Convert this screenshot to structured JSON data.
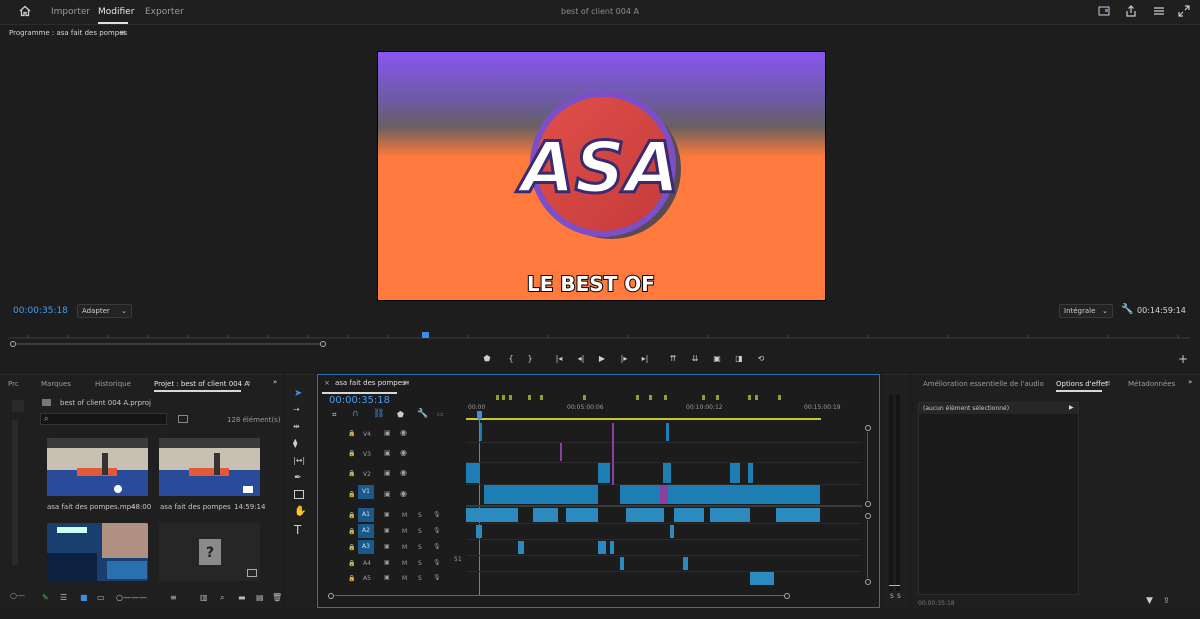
{
  "topbar": {
    "tabs": [
      "Importer",
      "Modifier",
      "Exporter"
    ],
    "active_tab": "Modifier",
    "document_title": "best of client 004 A"
  },
  "program": {
    "title": "Programme : asa fait des pompes",
    "timecode": "00:00:35:18",
    "fit_label": "Adapter",
    "quality_label": "Intégrale",
    "duration": "00:14:59:14",
    "video": {
      "logo_text": "ASA",
      "subtitle": "LE BEST OF"
    }
  },
  "project": {
    "truncated_tab": "Prc",
    "tabs": [
      "Marques",
      "Historique",
      "Projet : best of client 004 A"
    ],
    "project_file": "best of client 004 A.prproj",
    "item_count": "128 élément(s)",
    "items": [
      {
        "name": "asa fait des pompes.mp4",
        "duration": "48:00"
      },
      {
        "name": "asa fait des pompes",
        "duration": "14:59:14"
      },
      {
        "name": "",
        "duration": ""
      },
      {
        "name": "",
        "duration": ""
      }
    ]
  },
  "timeline": {
    "tab_title": "asa fait des pompes",
    "timecode": "00:00:35:18",
    "ruler": [
      "00:00",
      "00:05:00:06",
      "00:10:00:12",
      "00:15:00:19"
    ],
    "video_tracks": [
      "V4",
      "V3",
      "V2",
      "V1"
    ],
    "audio_tracks": [
      "A1",
      "A2",
      "A3",
      "A4",
      "A5"
    ],
    "audio_extra": "51",
    "track_buttons": {
      "mute": "M",
      "solo": "S"
    }
  },
  "meters": {
    "labels": [
      "S",
      "S"
    ]
  },
  "effects": {
    "tabs": [
      "Amélioration essentielle de l'audio",
      "Options d'effet",
      "Métadonnées"
    ],
    "no_selection": "(aucun élément sélectionné)",
    "timecode": "00:00:35:18"
  },
  "colors": {
    "accent": "#4a9cf0",
    "clip_blue": "#1e7db3",
    "clip_purple": "#8b3fa0",
    "marker_green": "#8aa12f",
    "video_top": "#8a55f0",
    "video_bottom": "#ff7a3c"
  }
}
